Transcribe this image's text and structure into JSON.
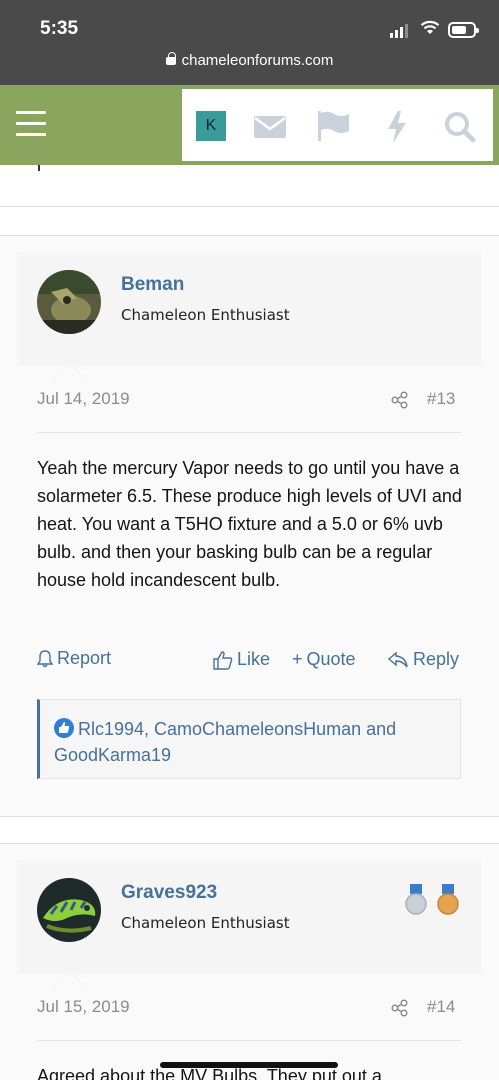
{
  "status_bar": {
    "time": "5:35",
    "url": "chameleonforums.com"
  },
  "header": {
    "avatar_letter": "K",
    "icons": [
      "menu-icon",
      "mail-icon",
      "flag-icon",
      "bolt-icon",
      "search-icon"
    ]
  },
  "posts": [
    {
      "username": "Beman",
      "user_title": "Chameleon Enthusiast",
      "date": "Jul 14, 2019",
      "post_number": "#13",
      "body": "Yeah the mercury Vapor needs to go until you have a solarmeter 6.5. These produce high levels of UVI and heat. You want a T5HO fixture and a 5.0 or 6% uvb bulb. and then your basking bulb can be a regular house hold incandescent bulb.",
      "actions": {
        "report": "Report",
        "like": "Like",
        "quote": "Quote",
        "reply": "Reply"
      },
      "likes_text": "Rlc1994, CamoChameleonsHuman and GoodKarma19"
    },
    {
      "username": "Graves923",
      "user_title": "Chameleon Enthusiast",
      "date": "Jul 15, 2019",
      "post_number": "#14",
      "body": "Agreed about the MV Bulbs. They put out a"
    }
  ],
  "colors": {
    "header_green": "#8aa65e",
    "link_blue": "#47709a",
    "status_bg": "#4a4a4a",
    "avatar_teal": "#3a9c9a"
  }
}
